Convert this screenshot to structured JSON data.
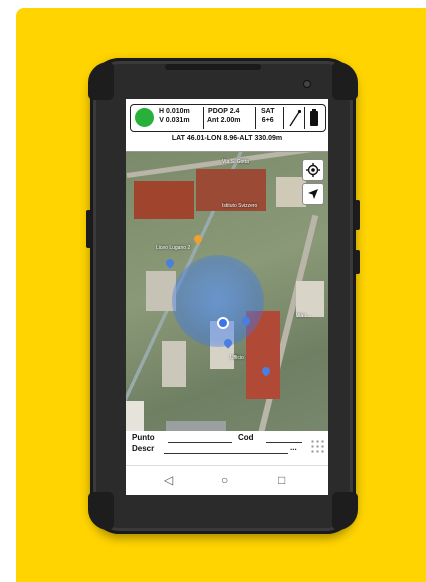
{
  "status": {
    "h_precision": "H 0.010m",
    "v_precision": "V 0.031m",
    "pdop": "PDOP 2.4",
    "antenna": "Ant 2.00m",
    "sat_label": "SAT",
    "sat_count": "6+6",
    "coordinates": "LAT 46.01-LON 8.96-ALT 330.09m",
    "fix_color": "#27b13b"
  },
  "map": {
    "street_top": "Via S. Gotta",
    "street_right": "Via L...",
    "place_1": "Liceo Lugano 2",
    "place_2": "Istituto Svizzero",
    "place_3": "Ufficio",
    "fab_label": "+"
  },
  "form": {
    "punto_label": "Punto",
    "cod_label": "Cod",
    "descr_label": "Descr",
    "more_label": "..."
  },
  "nav": {
    "back": "◁",
    "home": "○",
    "recent": "□"
  },
  "colors": {
    "background": "#FFD400",
    "fab": "#FFC107",
    "accuracy_area": "#3c78f0"
  }
}
